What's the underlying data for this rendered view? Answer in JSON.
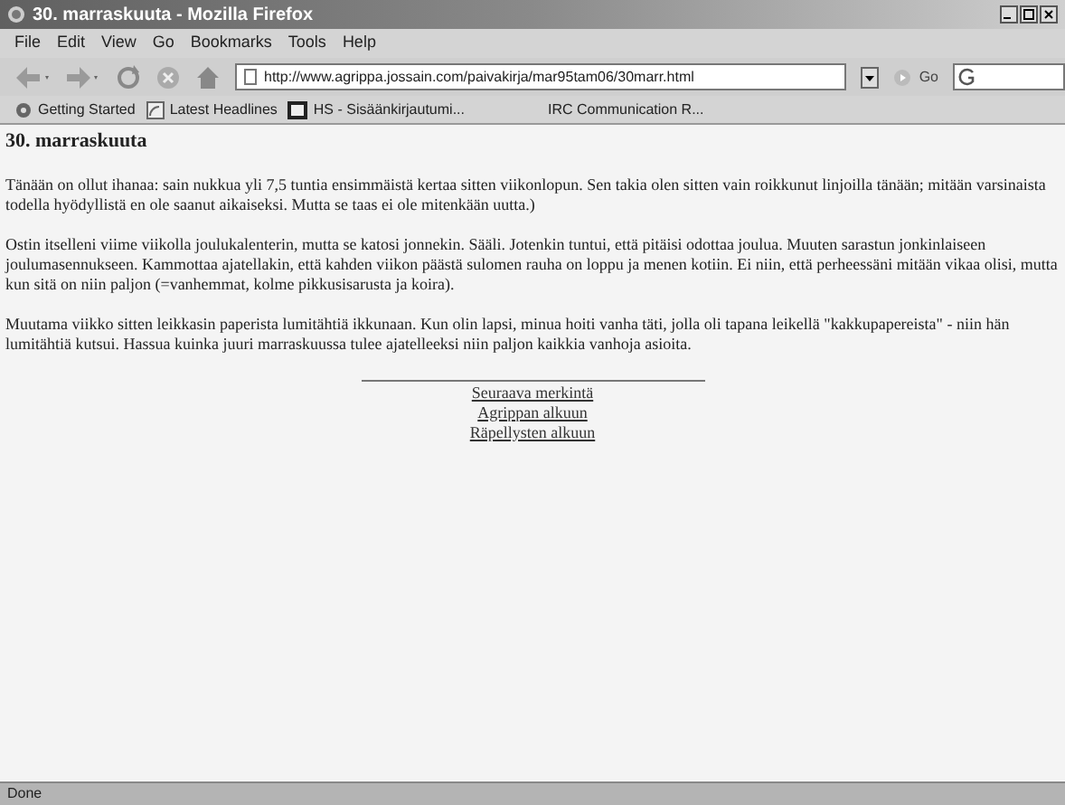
{
  "window": {
    "title": "30. marraskuuta - Mozilla Firefox"
  },
  "menu": [
    "File",
    "Edit",
    "View",
    "Go",
    "Bookmarks",
    "Tools",
    "Help"
  ],
  "toolbar": {
    "url": "http://www.agrippa.jossain.com/paivakirja/mar95tam06/30marr.html",
    "go": "Go"
  },
  "bookmarks": [
    {
      "label": "Getting Started",
      "kind": "gear"
    },
    {
      "label": "Latest Headlines",
      "kind": "feed"
    },
    {
      "label": "HS - Sisäänkirjautumi...",
      "kind": "hs"
    },
    {
      "label": "IRC Communication R...",
      "kind": "none"
    }
  ],
  "page": {
    "heading": "30. marraskuuta",
    "paragraphs": [
      "Tänään on ollut ihanaa: sain nukkua yli 7,5 tuntia ensimmäistä kertaa sitten viikonlopun. Sen takia olen sitten vain roikkunut linjoilla tänään; mitään varsinaista todella hyödyllistä en ole saanut aikaiseksi. Mutta se taas ei ole mitenkään uutta.)",
      "Ostin itselleni viime viikolla joulukalenterin, mutta se katosi jonnekin. Sääli. Jotenkin tuntui, että pitäisi odottaa joulua. Muuten sarastun jonkinlaiseen joulumasennukseen. Kammottaa ajatellakin, että kahden viikon päästä sulomen rauha on loppu ja menen kotiin. Ei niin, että perheessäni mitään vikaa olisi, mutta kun sitä on niin paljon (=vanhemmat, kolme pikkusisarusta ja koira).",
      "Muutama viikko sitten leikkasin paperista lumitähtiä ikkunaan. Kun olin lapsi, minua hoiti vanha täti, jolla oli tapana leikellä \"kakkupapereista\" - niin hän lumitähtiä kutsui. Hassua kuinka juuri marraskuussa tulee ajatelleeksi niin paljon kaikkia vanhoja asioita."
    ],
    "links": [
      "Seuraava merkintä",
      "Agrippan alkuun",
      "Räpellysten alkuun"
    ]
  },
  "status_bar": "Done"
}
